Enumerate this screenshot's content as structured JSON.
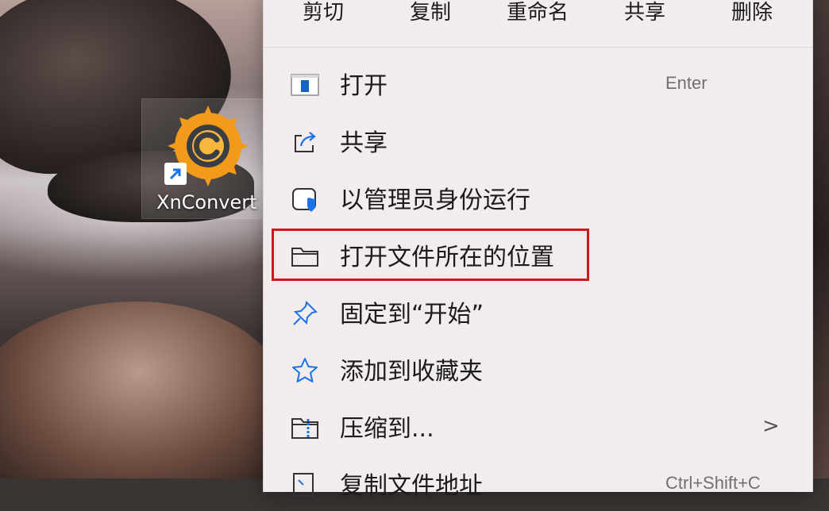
{
  "desktop": {
    "shortcut_label": "XnConvert",
    "shortcut_icon": "xnconvert-logo-icon"
  },
  "context_menu": {
    "toolbar": [
      {
        "label": "剪切",
        "icon": "cut-icon"
      },
      {
        "label": "复制",
        "icon": "copy-icon"
      },
      {
        "label": "重命名",
        "icon": "rename-icon"
      },
      {
        "label": "共享",
        "icon": "share-icon"
      },
      {
        "label": "删除",
        "icon": "delete-icon"
      }
    ],
    "items": [
      {
        "label": "打开",
        "accelerator": "Enter",
        "icon": "open-window-icon"
      },
      {
        "label": "共享",
        "accelerator": "",
        "icon": "share-icon"
      },
      {
        "label": "以管理员身份运行",
        "accelerator": "",
        "icon": "admin-shield-icon"
      },
      {
        "label": "打开文件所在的位置",
        "accelerator": "",
        "icon": "folder-icon",
        "highlighted": true
      },
      {
        "label": "固定到“开始”",
        "accelerator": "",
        "icon": "pin-icon"
      },
      {
        "label": "添加到收藏夹",
        "accelerator": "",
        "icon": "star-icon"
      },
      {
        "label": "压缩到...",
        "accelerator": "",
        "icon": "zip-folder-icon",
        "submenu": ">"
      },
      {
        "label": "复制文件地址",
        "accelerator": "Ctrl+Shift+C",
        "icon": "copy-path-icon"
      }
    ]
  },
  "colors": {
    "highlight_border": "#d4141c",
    "menu_background": "#f2ecec",
    "accent_blue": "#1a73e8",
    "xn_orange": "#f29a1a"
  }
}
